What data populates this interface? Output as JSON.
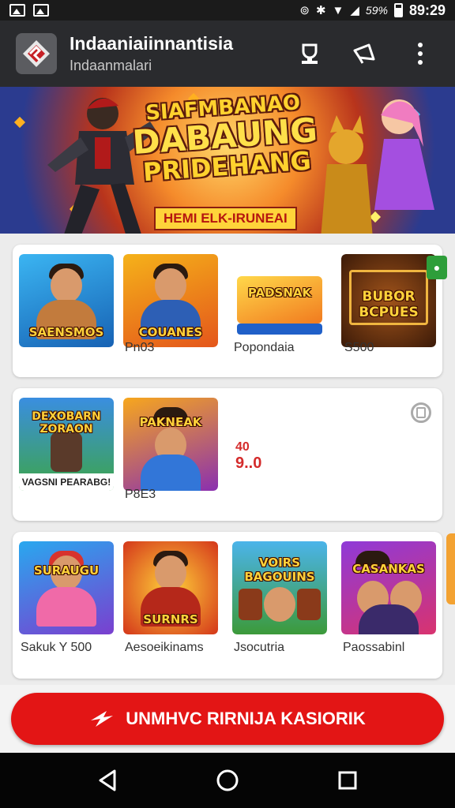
{
  "status_bar": {
    "battery_text": "59%",
    "time": "89:29"
  },
  "app_bar": {
    "title": "Indaaniaiinnantisia",
    "subtitle": "Indaanmalari",
    "icons": [
      "trophy-icon",
      "megaphone-icon",
      "more-vert-icon"
    ]
  },
  "banner": {
    "line1": "SIAFMBANAO",
    "line2": "DABAUNG",
    "line3": "PRIDEHANG",
    "tag": "HEMI ELK-IRUNEAI"
  },
  "section1": {
    "tiles": [
      {
        "art_text": "SAENSMOS",
        "caption": ""
      },
      {
        "art_text": "COUANES",
        "caption": "Pn03"
      },
      {
        "art_text": "PADSNAK",
        "caption": "Popondaia"
      },
      {
        "art_text": "BUBOR BCPUES",
        "caption": "S500"
      }
    ]
  },
  "section2": {
    "tiles": [
      {
        "art_text": "DEXOBARN ZORAON",
        "caption": "",
        "banner": "VAGSNI PEARABG!"
      },
      {
        "art_text": "PAKNEAK",
        "caption": "P8E3"
      }
    ],
    "promo_line1": "40",
    "promo_line2": "9..0"
  },
  "section3": {
    "tiles": [
      {
        "art_text": "SURAUGU",
        "caption": "Sakuk Y 500"
      },
      {
        "art_text": "SURNRS",
        "caption": "Aesoeikinams"
      },
      {
        "art_text": "VOIRS BAGOUINS",
        "caption": "Jsocutria"
      },
      {
        "art_text": "CASANKAS",
        "caption": "Paossabinl"
      }
    ]
  },
  "cta": {
    "label": "UNMHVC RIRNIJA KASIORIK"
  },
  "colors": {
    "cta_red": "#e31515",
    "app_bar": "#2a2b2e",
    "badge_green": "#2e9e3a"
  }
}
